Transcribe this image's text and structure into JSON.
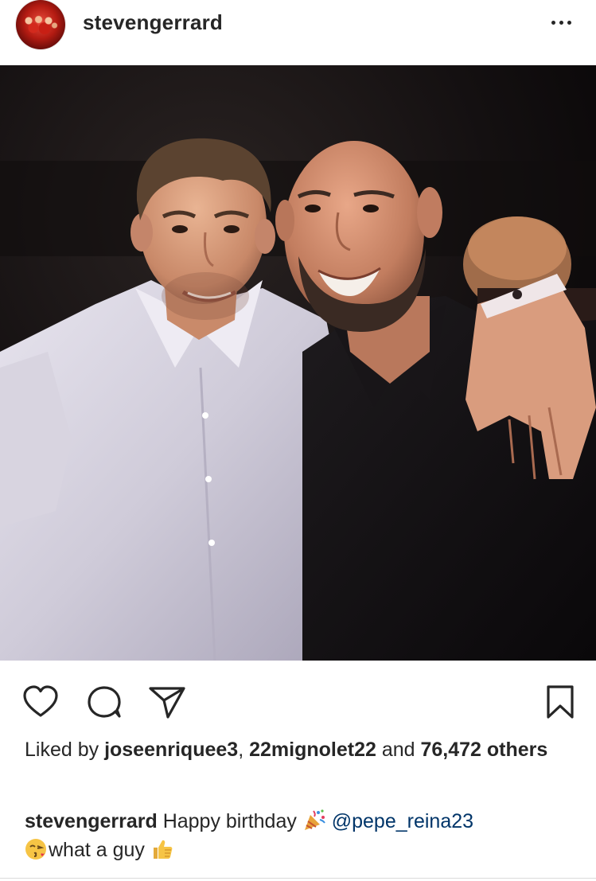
{
  "post": {
    "username": "stevengerrard",
    "avatar_icon": "profile-photo-avatar",
    "more_icon": "more-options-icon"
  },
  "photo": {
    "description_icon": "photo-two-men-night"
  },
  "actions": {
    "like_icon": "heart-icon",
    "comment_icon": "comment-icon",
    "share_icon": "paper-plane-icon",
    "save_icon": "bookmark-icon"
  },
  "likes": {
    "prefix": "Liked by ",
    "liker_1": "joseenriquee3",
    "separator": ", ",
    "liker_2": "22mignolet22",
    "middle": " and ",
    "others_count": "76,472 others"
  },
  "caption": {
    "author": "stevengerrard",
    "text_1": " Happy birthday ",
    "emoji_1": "party-popper-emoji",
    "mention": "@pepe_reina23",
    "emoji_2": "kissing-face-emoji",
    "text_2": "what a guy ",
    "emoji_3": "thumbs-up-emoji"
  },
  "colors": {
    "text": "#262626",
    "mention": "#003569",
    "divider": "#dbdbdb"
  }
}
